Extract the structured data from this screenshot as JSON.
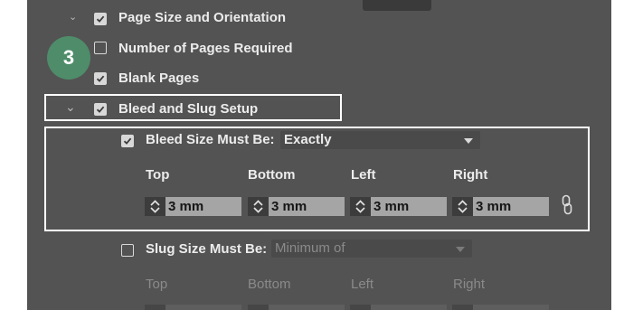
{
  "colors": {
    "panel_bg": "#535353",
    "badge_bg": "#4f8c6a",
    "highlight": "#ffffff"
  },
  "items": {
    "page_size": "Page Size and Orientation",
    "num_pages": "Number of Pages Required",
    "blank_pages": "Blank Pages",
    "bleed_slug": "Bleed and Slug Setup"
  },
  "step_badge": "3",
  "bleed": {
    "label": "Bleed Size Must Be:",
    "mode": "Exactly",
    "checked": true,
    "columns": [
      "Top",
      "Bottom",
      "Left",
      "Right"
    ],
    "values": [
      "3 mm",
      "3 mm",
      "3 mm",
      "3 mm"
    ],
    "link_icon": "chain-link-icon"
  },
  "slug": {
    "label": "Slug Size Must Be:",
    "mode": "Minimum of",
    "checked": false,
    "columns": [
      "Top",
      "Bottom",
      "Left",
      "Right"
    ]
  }
}
